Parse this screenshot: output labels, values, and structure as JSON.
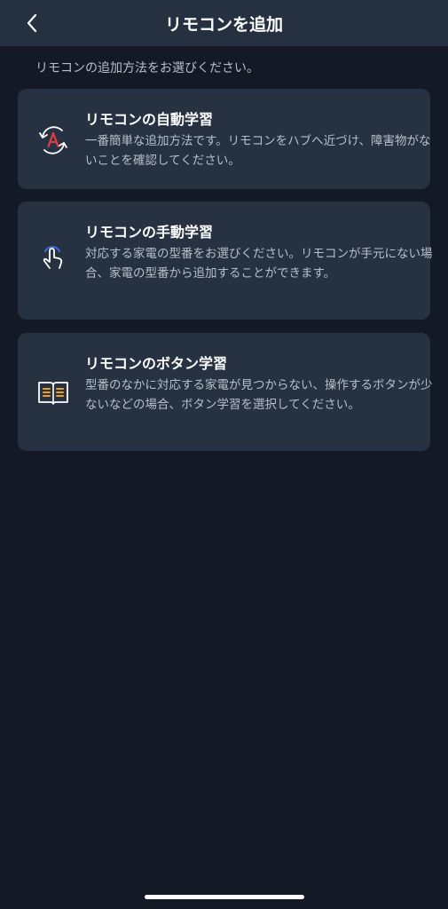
{
  "header": {
    "title": "リモコンを追加"
  },
  "subtitle": "リモコンの追加方法をお選びください。",
  "options": [
    {
      "title": "リモコンの自動学習",
      "description": "一番簡単な追加方法です。リモコンをハブへ近づけ、障害物がないことを確認してください。",
      "icon": "auto-learn-icon"
    },
    {
      "title": "リモコンの手動学習",
      "description": "対応する家電の型番をお選びください。リモコンが手元にない場合、家電の型番から追加することができます。",
      "icon": "hand-touch-icon"
    },
    {
      "title": "リモコンのボタン学習",
      "description": "型番のなかに対応する家電が見つからない、操作するボタンが少ないなどの場合、ボタン学習を選択してください。",
      "icon": "book-icon"
    }
  ],
  "colors": {
    "background": "#131a25",
    "header": "#253040",
    "card": "#263142",
    "accent_red": "#e23b44",
    "accent_blue": "#3d6fe0",
    "accent_orange": "#f0a020"
  }
}
